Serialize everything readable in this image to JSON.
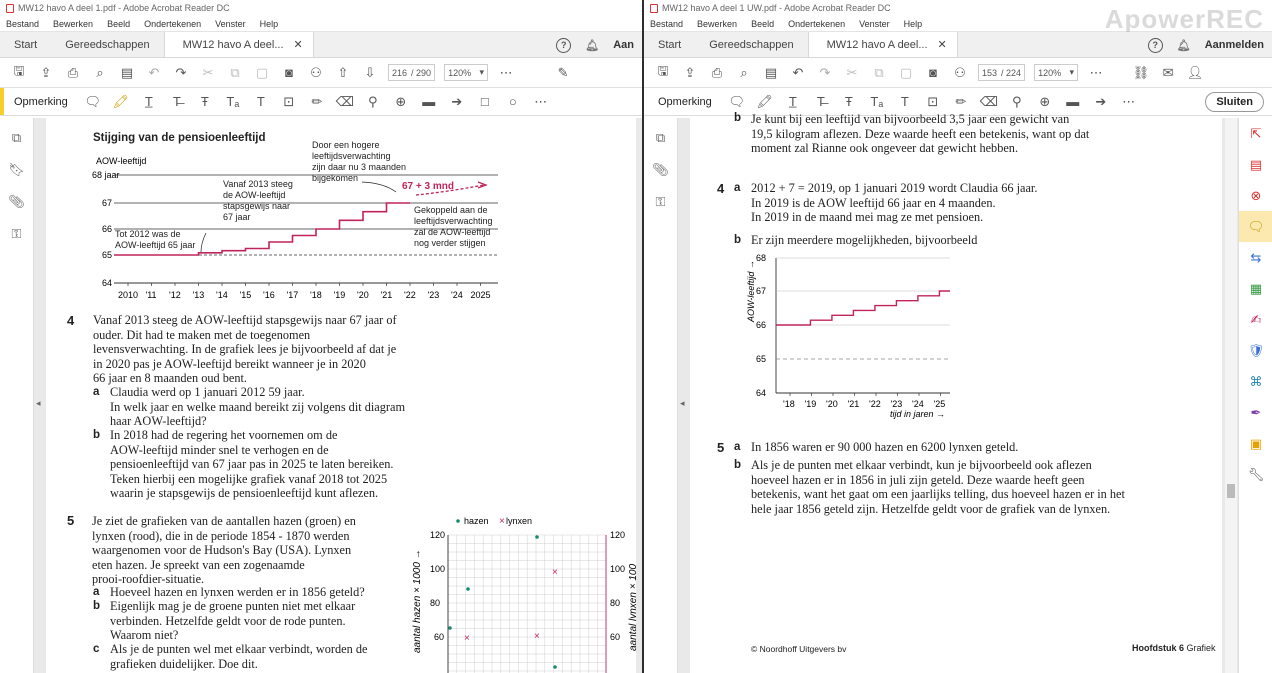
{
  "left_window": {
    "title": "MW12 havo A deel 1.pdf - Adobe Acrobat Reader DC",
    "menu": [
      "Bestand",
      "Bewerken",
      "Beeld",
      "Ondertekenen",
      "Venster",
      "Help"
    ],
    "tabs": {
      "start": "Start",
      "tools": "Gereedschappen",
      "doc": "MW12 havo A deel...",
      "right_partial": "Aan"
    },
    "page_current": "216",
    "page_total": "/ 290",
    "zoom": "120%",
    "comment_label": "Opmerking",
    "graph1": {
      "title": "Stijging van de pensioenleeftijd",
      "ylabel": "AOW-leeftijd",
      "yticks": [
        "68 jaar",
        "67",
        "66",
        "65",
        "64"
      ],
      "xticks": [
        "2010",
        "'11",
        "'12",
        "'13",
        "'14",
        "'15",
        "'16",
        "'17",
        "'18",
        "'19",
        "'20",
        "'21",
        "'22",
        "'23",
        "'24",
        "2025"
      ],
      "ann_top": [
        "Door een hogere",
        "leeftijdsverwachting",
        "zijn daar nu 3 maanden",
        "bijgekomen"
      ],
      "ann_mid": [
        "Vanaf 2013 steeg",
        "de AOW-leeftijd",
        "stapsgewijs naar",
        "67 jaar"
      ],
      "ann_red": "67 + 3 mnd",
      "ann_right": [
        "Gekoppeld aan de",
        "leeftijdsverwachting",
        "zal de AOW-leeftijd",
        "nog verder stijgen"
      ],
      "ann_left": [
        "Tot 2012 was de",
        "AOW-leeftijd 65 jaar"
      ],
      "color_line": "#c0245c"
    },
    "q4": {
      "num": "4",
      "lines": [
        "Vanaf 2013 steeg de AOW-leeftijd stapsgewijs naar 67 jaar of",
        "ouder. Dit had te maken met de toegenomen",
        "levensverwachting. In de grafiek lees je bijvoorbeeld af dat je",
        "in 2020 pas je AOW-leeftijd bereikt wanneer je in 2020",
        "66 jaar en 8 maanden oud bent."
      ],
      "a_label": "a",
      "a_lines": [
        "Claudia werd op 1 januari 2012 59 jaar.",
        "In welk jaar en welke maand bereikt zij volgens dit diagram",
        "haar AOW-leeftijd?"
      ],
      "b_label": "b",
      "b_lines": [
        "In 2018 had de regering het voornemen om de",
        "AOW-leeftijd minder snel te verhogen en de",
        "pensioenleeftijd van 67 jaar pas in 2025 te laten bereiken.",
        "Teken hierbij een mogelijke grafiek vanaf 2018 tot 2025",
        "waarin je stapsgewijs de pensioenleeftijd kunt aflezen."
      ]
    },
    "q5": {
      "num": "5",
      "lines": [
        "Je ziet de grafieken van de aantallen hazen (groen) en",
        "lynxen (rood), die in de periode 1854 - 1870 werden",
        "waargenomen voor de Hudson's Bay (USA). Lynxen",
        "eten hazen. Je spreekt van een zogenaamde",
        "prooi-roofdier-situatie."
      ],
      "a_label": "a",
      "a_lines": [
        "Hoeveel hazen en lynxen werden er in 1856 geteld?"
      ],
      "b_label": "b",
      "b_lines": [
        "Eigenlijk mag je de groene punten niet met elkaar",
        "verbinden. Hetzelfde geldt voor de rode punten.",
        "Waarom niet?"
      ],
      "c_label": "c",
      "c_lines": [
        "Als je de punten wel met elkaar verbindt, worden de",
        "grafieken duidelijker. Doe dit."
      ]
    },
    "graph2": {
      "legend_hazen": "hazen",
      "legend_lynxen": "lynxen",
      "ylabel_left": "aantal hazen × 1000 →",
      "ylabel_right": "aantal lynxen × 100",
      "yticks": [
        "120",
        "100",
        "80",
        "60"
      ],
      "color_hazen": "#1a8a6e",
      "color_lynx": "#c0245c"
    }
  },
  "right_window": {
    "title": "MW12 havo A deel 1 UW.pdf - Adobe Acrobat Reader DC",
    "menu": [
      "Bestand",
      "Bewerken",
      "Beeld",
      "Ondertekenen",
      "Venster",
      "Help"
    ],
    "tabs": {
      "start": "Start",
      "tools": "Gereedschappen",
      "doc": "MW12 havo A deel...",
      "signin": "Aanmelden"
    },
    "page_current": "153",
    "page_total": "/ 224",
    "zoom": "120%",
    "comment_label": "Opmerking",
    "close_label": "Sluiten",
    "watermark": "ApowerREC",
    "top_b": "b",
    "top_lines": [
      "Je kunt bij een leeftijd van bijvoorbeeld 3,5 jaar een gewicht van",
      "19,5 kilogram aflezen. Deze waarde heeft een betekenis, want op dat",
      "moment zal Rianne ook ongeveer dat gewicht hebben."
    ],
    "q4": {
      "num": "4",
      "a_label": "a",
      "a_lines": [
        "2012 + 7 = 2019, op 1 januari 2019 wordt Claudia 66 jaar.",
        "In 2019 is de AOW leeftijd 66 jaar en 4 maanden.",
        "In 2019 in de maand mei mag ze met pensioen."
      ],
      "b_label": "b",
      "b_lines": [
        "Er zijn meerdere mogelijkheden, bijvoorbeeld"
      ]
    },
    "graph3": {
      "ylabel": "AOW-leeftijd →",
      "xlabel": "tijd in jaren →",
      "yticks": [
        "68",
        "67",
        "66",
        "65",
        "64"
      ],
      "xticks": [
        "'18",
        "'19",
        "'20",
        "'21",
        "'22",
        "'23",
        "'24",
        "'25"
      ],
      "color_line": "#c0245c"
    },
    "q5": {
      "num": "5",
      "a_label": "a",
      "a_lines": [
        "In 1856 waren er 90 000 hazen en 6200 lynxen geteld."
      ],
      "b_label": "b",
      "b_lines": [
        "Als je de punten met elkaar verbindt, kun je bijvoorbeeld ook aflezen",
        "hoeveel hazen er in 1856 in juli zijn geteld. Deze waarde heeft geen",
        "betekenis, want het gaat om een jaarlijks telling, dus hoeveel hazen er in het",
        "hele jaar 1856 geteld zijn. Hetzelfde geldt voor de grafiek van de lynxen."
      ]
    },
    "footer_left": "© Noordhoff Uitgevers bv",
    "footer_right_bold": "Hoofdstuk 6",
    "footer_right": " Grafiek"
  }
}
